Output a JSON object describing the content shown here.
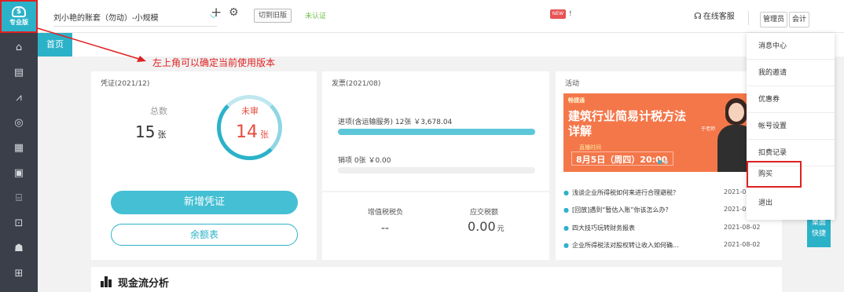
{
  "sidebar": {
    "brand_label": "专业版",
    "icons": [
      "home-icon",
      "voucher-icon",
      "chart-icon",
      "tax-icon",
      "ledger-icon",
      "report-icon",
      "asset-icon",
      "cashier-icon",
      "payroll-icon",
      "settings-icon"
    ]
  },
  "topbar": {
    "account_name": "刘小艳的账套（勿动）-小规模",
    "switch_old": "切到旧版",
    "unverified": "未认证",
    "msg_badge": "NEW",
    "msg_tail": "!",
    "service": "在线客服",
    "role_admin": "管理员",
    "role_accountant": "会计"
  },
  "tabs": {
    "home": "首页"
  },
  "annotation": "左上角可以确定当前使用版本",
  "voucher": {
    "title": "凭证(2021/12)",
    "total_label": "总数",
    "total_value": "15",
    "total_unit": "张",
    "unaudited_label": "未审",
    "unaudited_value": "14",
    "unaudited_unit": "张",
    "new_button": "新增凭证",
    "balance_button": "余额表",
    "unaudited_ratio": 0.93
  },
  "invoice": {
    "title": "发票(2021/08)",
    "input_label": "进项(含运输服务)  12张  ￥3,678.04",
    "input_fill": 1.0,
    "output_label": "销项   0张    ￥0.00",
    "output_fill": 0.0
  },
  "tax": {
    "burden_label": "增值税税负",
    "burden_value": "--",
    "payable_label": "应交税额",
    "payable_value": "0.00",
    "payable_unit": "元"
  },
  "activity": {
    "title": "活动",
    "banner_brand": "畅捷通",
    "banner_headline": "建筑行业简易计税方法详解",
    "banner_live": "直播时间",
    "banner_date": "8月5日（周四）20:00",
    "banner_speaker": "于老师",
    "news": [
      {
        "title": "浅谈企业所得税如何来进行合理避税？",
        "date": "2021-0"
      },
      {
        "title": "[回放]遇到“暂估入账”你该怎么办？",
        "date": "2021-0"
      },
      {
        "title": "四大技巧玩转财务报表",
        "date": "2021-08-02"
      },
      {
        "title": "企业所得税法对股权转让收入如何确...",
        "date": "2021-08-02"
      }
    ]
  },
  "cash": {
    "title": "现金流分析"
  },
  "quick": {
    "label1": "桌面",
    "label2": "快捷"
  },
  "menu": {
    "items": [
      "消息中心",
      "我的邀请",
      "优惠券",
      "帐号设置",
      "扣费记录",
      "购买",
      "退出"
    ]
  },
  "colors": {
    "accent": "#2bb2c9",
    "sidebar": "#3a3f4a",
    "alert": "#e02020",
    "verified": "#73c04a"
  }
}
